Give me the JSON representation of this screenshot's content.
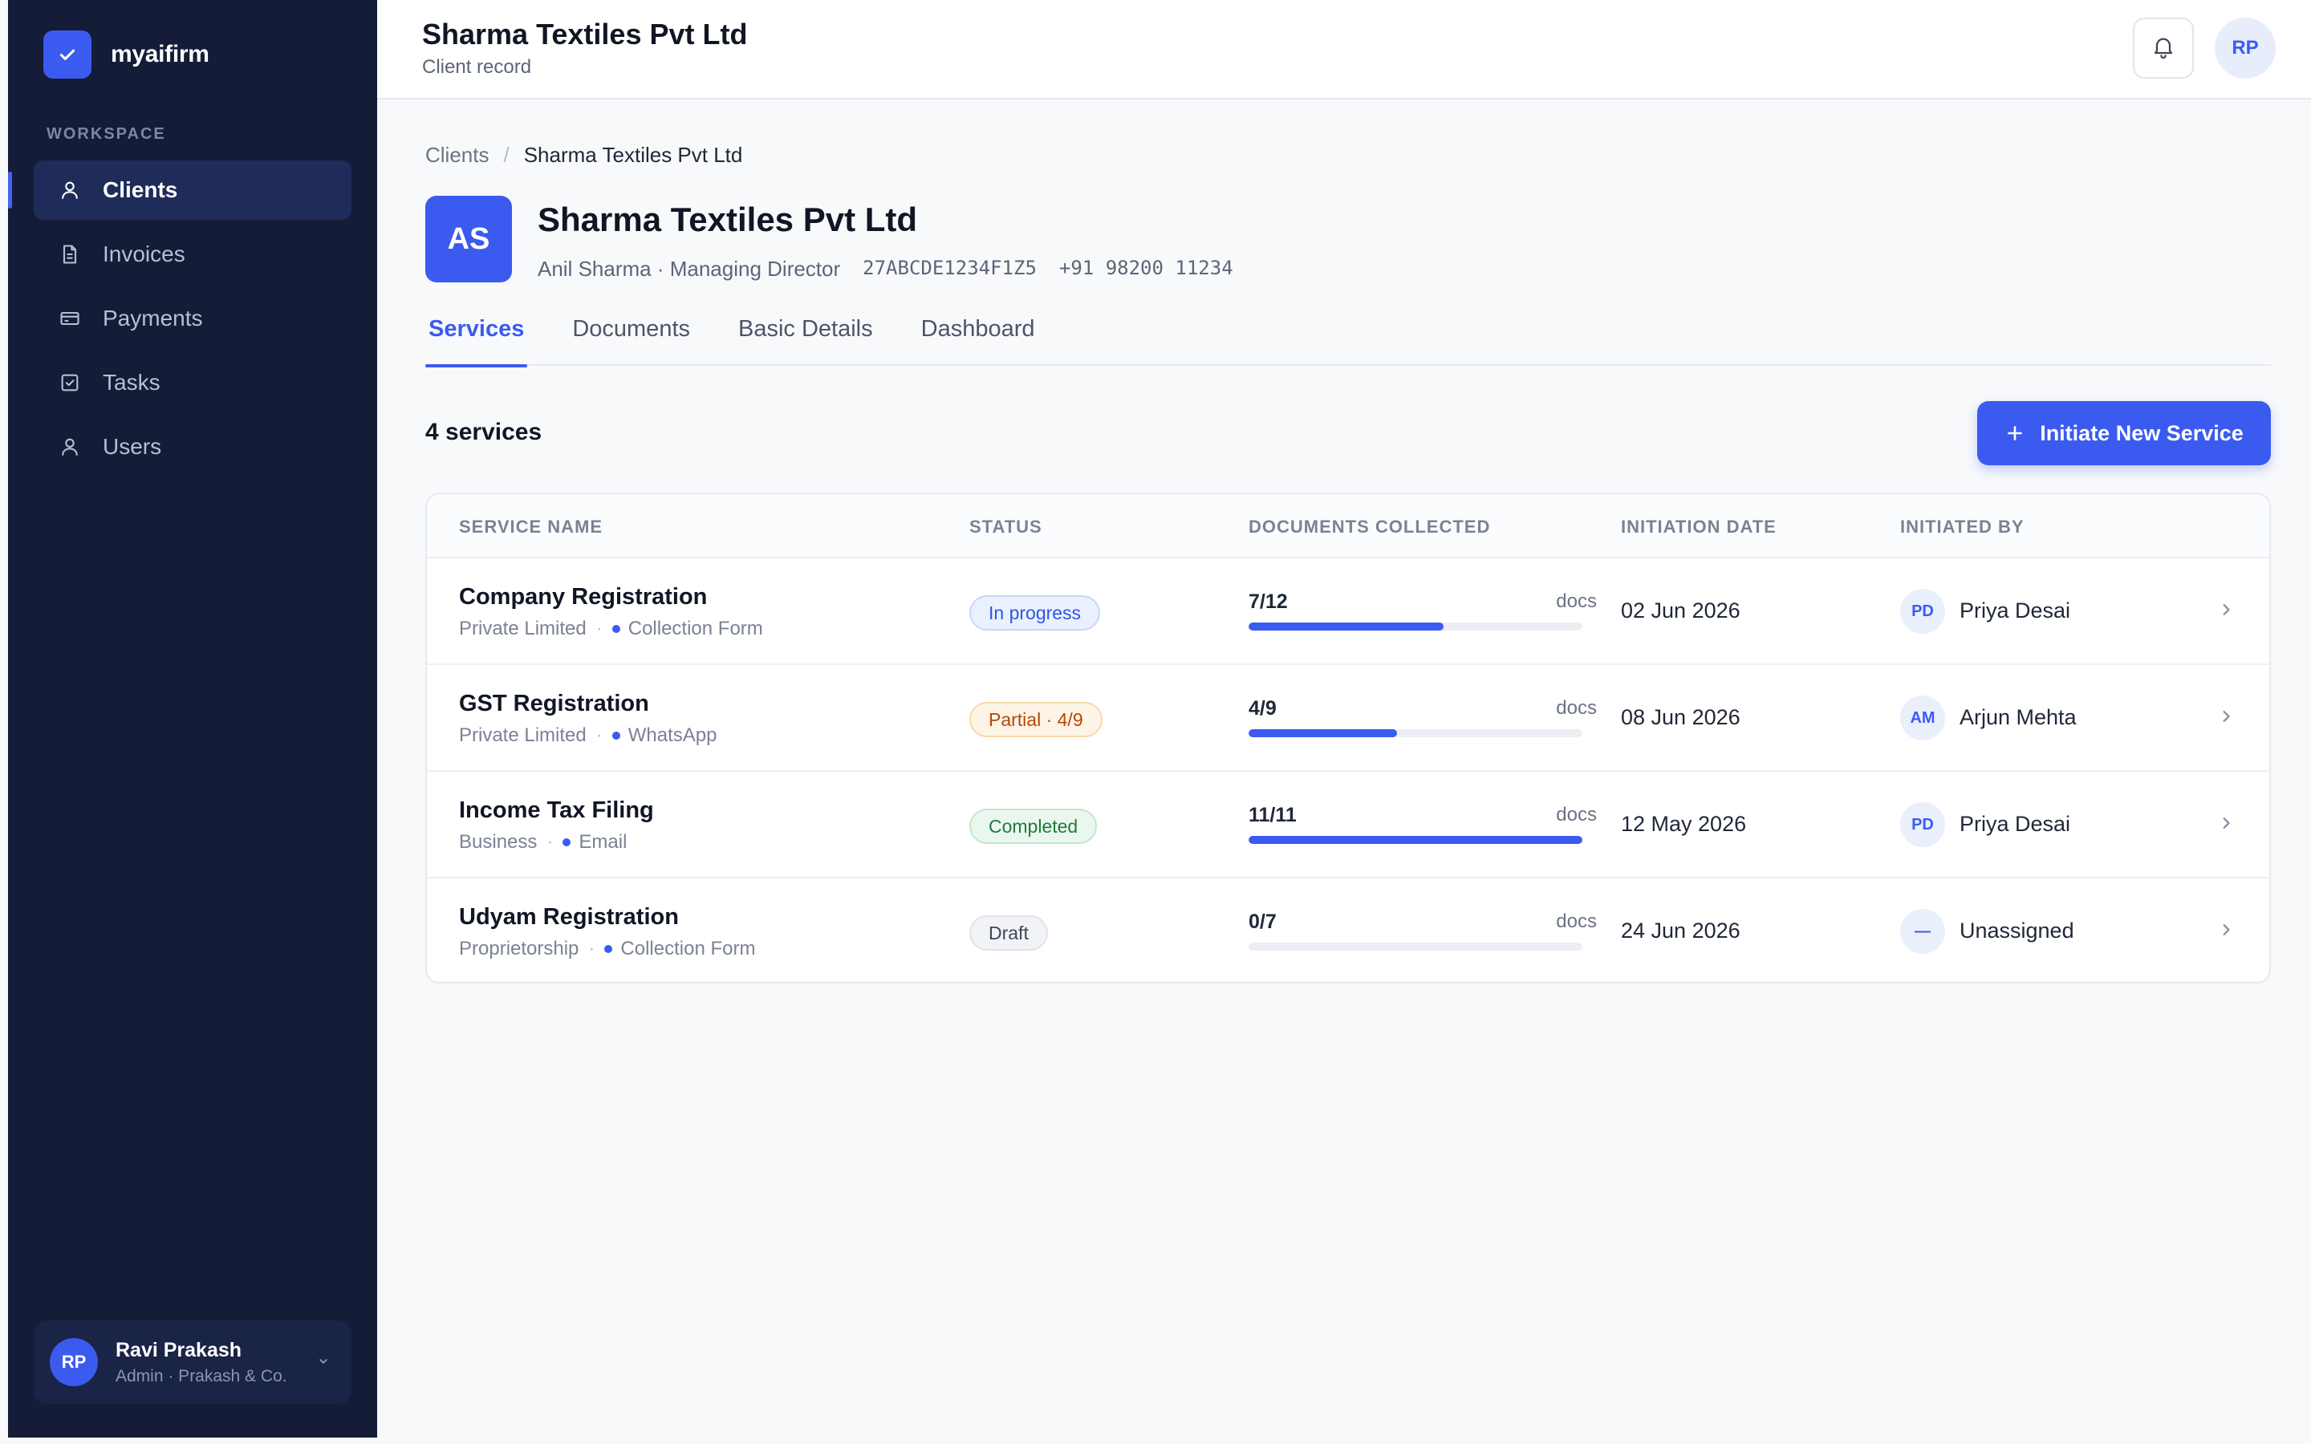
{
  "app": {
    "name": "myaifirm"
  },
  "sidebar": {
    "section_label": "WORKSPACE",
    "items": [
      {
        "label": "Clients",
        "icon": "user-icon",
        "active": true
      },
      {
        "label": "Invoices",
        "icon": "document-icon",
        "active": false
      },
      {
        "label": "Payments",
        "icon": "card-icon",
        "active": false
      },
      {
        "label": "Tasks",
        "icon": "checkbox-icon",
        "active": false
      },
      {
        "label": "Users",
        "icon": "user-icon",
        "active": false
      }
    ],
    "user": {
      "initials": "RP",
      "name": "Ravi Prakash",
      "role": "Admin · Prakash & Co."
    }
  },
  "topbar": {
    "title": "Sharma Textiles Pvt Ltd",
    "subtitle": "Client record",
    "avatar_initials": "RP"
  },
  "breadcrumb": {
    "parent": "Clients",
    "separator": "/",
    "current": "Sharma Textiles Pvt Ltd"
  },
  "client": {
    "initials": "AS",
    "name": "Sharma Textiles Pvt Ltd",
    "contact": "Anil Sharma · Managing Director",
    "gstin": "27ABCDE1234F1Z5",
    "phone": "+91 98200 11234"
  },
  "tabs": [
    {
      "label": "Services",
      "active": true
    },
    {
      "label": "Documents",
      "active": false
    },
    {
      "label": "Basic Details",
      "active": false
    },
    {
      "label": "Dashboard",
      "active": false
    }
  ],
  "services": {
    "count_label": "4 services",
    "new_button": "Initiate New Service",
    "columns": [
      "SERVICE NAME",
      "STATUS",
      "DOCUMENTS COLLECTED",
      "INITIATION DATE",
      "INITIATED BY"
    ],
    "rows": [
      {
        "name": "Company Registration",
        "entity": "Private Limited",
        "channel": "Collection Form",
        "status": "In progress",
        "status_tone": "blue",
        "docs": "7/12",
        "docs_fraction": 0.583,
        "docs_unit": "docs",
        "date": "02 Jun 2026",
        "by_initials": "PD",
        "by_name": "Priya Desai"
      },
      {
        "name": "GST Registration",
        "entity": "Private Limited",
        "channel": "WhatsApp",
        "status": "Partial · 4/9",
        "status_tone": "orange",
        "docs": "4/9",
        "docs_fraction": 0.444,
        "docs_unit": "docs",
        "date": "08 Jun 2026",
        "by_initials": "AM",
        "by_name": "Arjun Mehta"
      },
      {
        "name": "Income Tax Filing",
        "entity": "Business",
        "channel": "Email",
        "status": "Completed",
        "status_tone": "green",
        "docs": "11/11",
        "docs_fraction": 1.0,
        "docs_unit": "docs",
        "date": "12 May 2026",
        "by_initials": "PD",
        "by_name": "Priya Desai"
      },
      {
        "name": "Udyam Registration",
        "entity": "Proprietorship",
        "channel": "Collection Form",
        "status": "Draft",
        "status_tone": "gray",
        "docs": "0/7",
        "docs_fraction": 0.0,
        "docs_unit": "docs",
        "date": "24 Jun 2026",
        "by_initials": "—",
        "by_name": "Unassigned"
      }
    ]
  },
  "colors": {
    "accent": "#3b5bf0",
    "sidebar_bg": "#141c37",
    "page_bg": "#f8f9fb"
  }
}
